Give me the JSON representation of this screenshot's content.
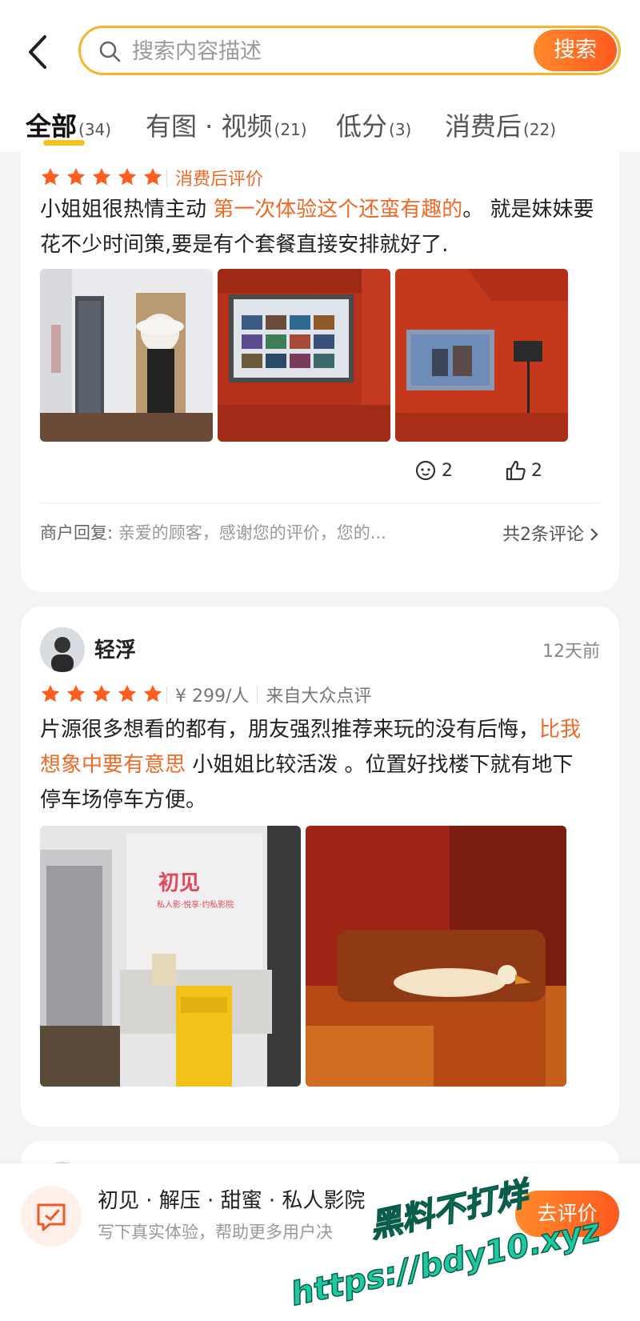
{
  "search": {
    "placeholder": "搜索内容描述",
    "button": "搜索"
  },
  "tabs": [
    {
      "label": "全部",
      "count": "(34)"
    },
    {
      "label": "有图 · 视频",
      "count": "(21)"
    },
    {
      "label": "低分",
      "count": "(3)"
    },
    {
      "label": "消费后",
      "count": "(22)"
    }
  ],
  "review1": {
    "rating": 5,
    "tag": "消费后评价",
    "text_a": "小姐姐很热情主动 ",
    "text_highlight": "第一次体验这个还蛮有趣的",
    "text_b": "。 就是妹妹要花不少时间策,要是有个套餐直接安排就好了.",
    "comments": "2",
    "likes": "2",
    "reply_label": "商户回复:",
    "reply_text": "亲爱的顾客，感谢您的评价，您的...",
    "more": "共2条评论"
  },
  "review2": {
    "user": "轻浮",
    "time": "12天前",
    "rating": 5,
    "price": "¥ 299/人",
    "source": "来自大众点评",
    "text_a": "片源很多想看的都有，朋友强烈推荐来玩的没有后悔，",
    "text_highlight": "比我想象中要有意思",
    "text_b": " 小姐姐比较活泼 。位置好找楼下就有地下停车场停车方便。",
    "sign_text": "初见",
    "sign_sub": "私人影·悦享·约私影院"
  },
  "bottom": {
    "title": "初见 · 解压 · 甜蜜 · 私人影院",
    "subtitle": "写下真实体验，帮助更多用户决",
    "button": "去评价"
  },
  "watermark": {
    "line1": "黑料不打烊",
    "line2": "https://bdy10.xyz"
  },
  "colors": {
    "accent": "#ff6a24",
    "star": "#ff5e1e",
    "highlight": "#f06a26",
    "tab_indicator": "#f9c21b"
  }
}
